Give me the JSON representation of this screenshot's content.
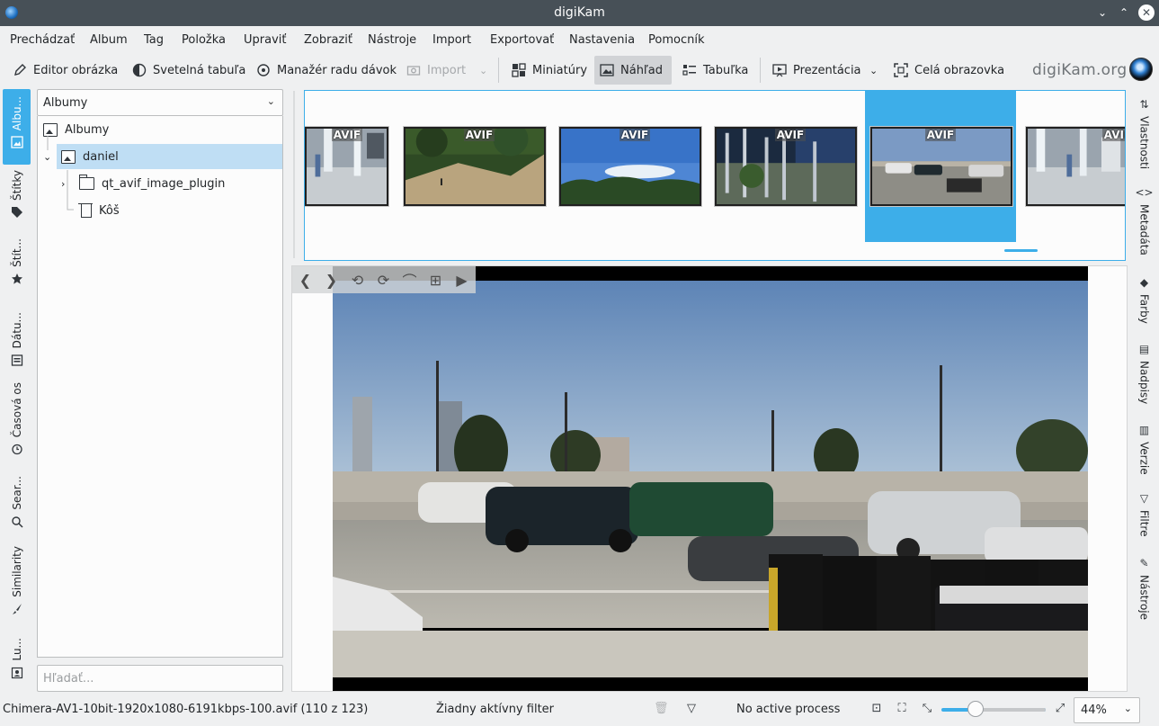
{
  "window": {
    "title": "digiKam"
  },
  "menu": [
    "Prechádzať",
    "Album",
    "Tag",
    "Položka",
    "Upraviť",
    "Zobraziť",
    "Nástroje",
    "Import",
    "Exportovať",
    "Nastavenia",
    "Pomocník"
  ],
  "toolbar": {
    "image_editor": "Editor obrázka",
    "light_table": "Svetelná tabuľa",
    "batch_queue": "Manažér radu dávok",
    "import": "Import",
    "thumbnails": "Miniatúry",
    "preview": "Náhľad",
    "table": "Tabuľka",
    "slideshow": "Prezentácia",
    "fullscreen": "Celá obrazovka",
    "brand": "digiKam.org"
  },
  "left_tabs": [
    "Albu...",
    "Štítky",
    "Štít...",
    "Dátu...",
    "Časová os",
    "Sear...",
    "Similarity",
    "Lu..."
  ],
  "albums": {
    "selector": "Albumy",
    "root": "Albumy",
    "user": "daniel",
    "child": "qt_avif_image_plugin",
    "trash": "Kôš"
  },
  "search": {
    "placeholder": "Hľadať..."
  },
  "thumb_badge": "AVIF",
  "right_tabs": [
    "Vlastnosti",
    "Metadáta",
    "Farby",
    "Nadpisy",
    "Verzie",
    "Filtre",
    "Nástroje"
  ],
  "status": {
    "file": "Chimera-AV1-10bit-1920x1080-6191kbps-100.avif (110 z 123)",
    "filter": "Žiadny aktívny filter",
    "process": "No active process",
    "zoom": "44%",
    "zoom_fraction": 0.33
  },
  "colors": {
    "accent": "#3daee9",
    "titlebar": "#475057",
    "background": "#eff0f1"
  }
}
